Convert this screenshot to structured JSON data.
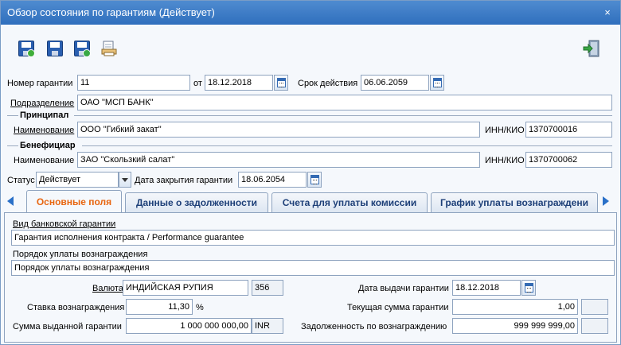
{
  "window": {
    "title": "Обзор состояния по гарантиям (Действует)",
    "close_symbol": "×"
  },
  "toolbar": {
    "buttons": [
      {
        "icon": "save-check-icon"
      },
      {
        "icon": "save-icon"
      },
      {
        "icon": "save-add-icon"
      },
      {
        "icon": "print-preview-icon"
      }
    ],
    "exit_icon": "exit-door-icon"
  },
  "guarantee": {
    "number_label": "Номер гарантии",
    "number_value": "11",
    "date_from_label": "от",
    "date_from_value": "18.12.2018",
    "validity_label": "Срок действия",
    "validity_value": "06.06.2059",
    "division_label": "Подразделение",
    "division_value": "ОАО \"МСП БАНК\""
  },
  "principal": {
    "section_title": "Принципал",
    "name_label": "Наименование",
    "name_value": "ООО \"Гибкий закат\"",
    "inn_label": "ИНН/КИО",
    "inn_value": "1370700016"
  },
  "beneficiary": {
    "section_title": "Бенефициар",
    "name_label": "Наименование",
    "name_value": "ЗАО \"Скользкий салат\"",
    "inn_label": "ИНН/КИО",
    "inn_value": "1370700062"
  },
  "status": {
    "label": "Статус",
    "value": "Действует",
    "close_date_label": "Дата закрытия гарантии",
    "close_date_value": "18.06.2054"
  },
  "tabs": [
    {
      "label": "Основные поля",
      "active": true
    },
    {
      "label": "Данные о задолженности",
      "active": false
    },
    {
      "label": "Счета для уплаты комиссии",
      "active": false
    },
    {
      "label": "График уплаты вознаграждени",
      "active": false
    }
  ],
  "main_tab": {
    "guarantee_type_label": "Вид банковской гарантии",
    "guarantee_type_value": "Гарантия исполнения контракта / Performance guarantee",
    "payment_order_label": "Порядок уплаты вознаграждения",
    "payment_order_value": "Порядок уплаты вознаграждения",
    "currency_label": "Валюта",
    "currency_value": "ИНДИЙСКАЯ РУПИЯ",
    "currency_code": "356",
    "issue_date_label": "Дата выдачи гарантии",
    "issue_date_value": "18.12.2018",
    "rate_label": "Ставка вознаграждения",
    "rate_value": "11,30",
    "rate_unit": "%",
    "current_amount_label": "Текущая сумма гарантии",
    "current_amount_value": "1,00",
    "issued_amount_label": "Сумма выданной гарантии",
    "issued_amount_value": "1 000 000 000,00",
    "issued_currency": "INR",
    "debt_label": "Задолженность по вознаграждению",
    "debt_value": "999 999 999,00"
  },
  "colors": {
    "title_bar": "#2f6fbd",
    "active_tab_text": "#e8650f",
    "tab_text": "#1d3f78"
  }
}
